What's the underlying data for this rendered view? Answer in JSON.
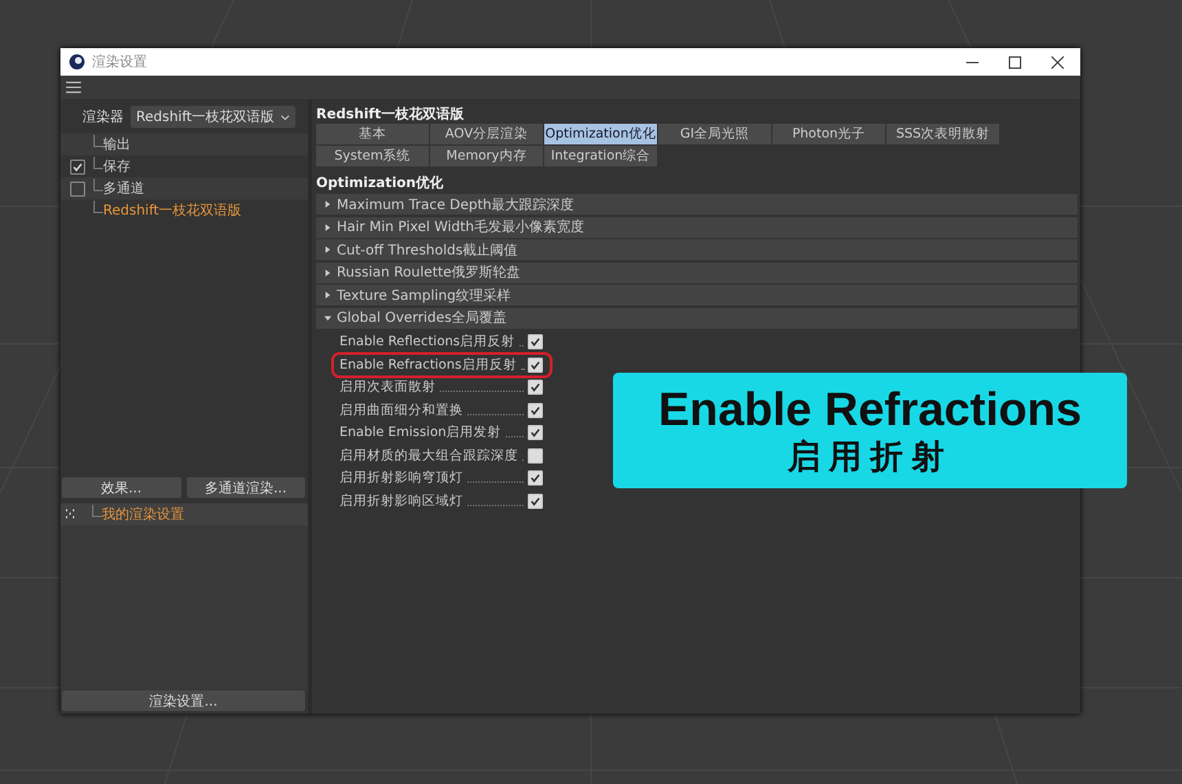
{
  "window": {
    "title": "渲染设置"
  },
  "left": {
    "renderer_label": "渲染器",
    "renderer_value": "Redshift一枝花双语版",
    "tree": [
      {
        "label": "输出",
        "selected": false
      },
      {
        "label": "保存",
        "checked": true,
        "selected": false
      },
      {
        "label": "多通道",
        "checked": false,
        "selected": false
      },
      {
        "label": "Redshift一枝花双语版",
        "selected": true
      }
    ],
    "buttons": [
      "效果...",
      "多通道渲染..."
    ],
    "presets": [
      {
        "label": "我的渲染设置",
        "selected": true
      }
    ],
    "bottom_button": "渲染设置..."
  },
  "right": {
    "title": "Redshift一枝花双语版",
    "tabs": [
      {
        "label": "基本",
        "selected": false
      },
      {
        "label": "AOV分层渲染",
        "selected": false
      },
      {
        "label": "Optimization优化",
        "selected": true
      },
      {
        "label": "GI全局光照",
        "selected": false
      },
      {
        "label": "Photon光子",
        "selected": false
      },
      {
        "label": "SSS次表明散射",
        "selected": false
      },
      {
        "label": "System系统",
        "selected": false
      },
      {
        "label": "Memory内存",
        "selected": false
      },
      {
        "label": "Integration综合",
        "selected": false
      }
    ],
    "section": "Optimization优化",
    "groups": [
      {
        "label": "Maximum Trace Depth最大跟踪深度",
        "expanded": false
      },
      {
        "label": "Hair Min Pixel Width毛发最小像素宽度",
        "expanded": false
      },
      {
        "label": "Cut-off Thresholds截止阈值",
        "expanded": false
      },
      {
        "label": "Russian Roulette俄罗斯轮盘",
        "expanded": false
      },
      {
        "label": "Texture Sampling纹理采样",
        "expanded": false
      },
      {
        "label": "Global Overrides全局覆盖",
        "expanded": true,
        "options": [
          {
            "label": "Enable Reflections启用反射",
            "checked": true,
            "highlighted": false
          },
          {
            "label": "Enable Refractions启用反射",
            "checked": true,
            "highlighted": true
          },
          {
            "label": "启用次表面散射",
            "checked": true,
            "highlighted": false
          },
          {
            "label": "启用曲面细分和置换",
            "checked": true,
            "highlighted": false
          },
          {
            "label": "Enable Emission启用发射",
            "checked": true,
            "highlighted": false
          },
          {
            "label": "启用材质的最大组合跟踪深度",
            "checked": false,
            "highlighted": false
          },
          {
            "label": "启用折射影响穹顶灯",
            "checked": true,
            "highlighted": false
          },
          {
            "label": "启用折射影响区域灯",
            "checked": true,
            "highlighted": false
          }
        ]
      }
    ]
  },
  "callout": {
    "title": "Enable Refractions",
    "subtitle": "启用折射"
  }
}
